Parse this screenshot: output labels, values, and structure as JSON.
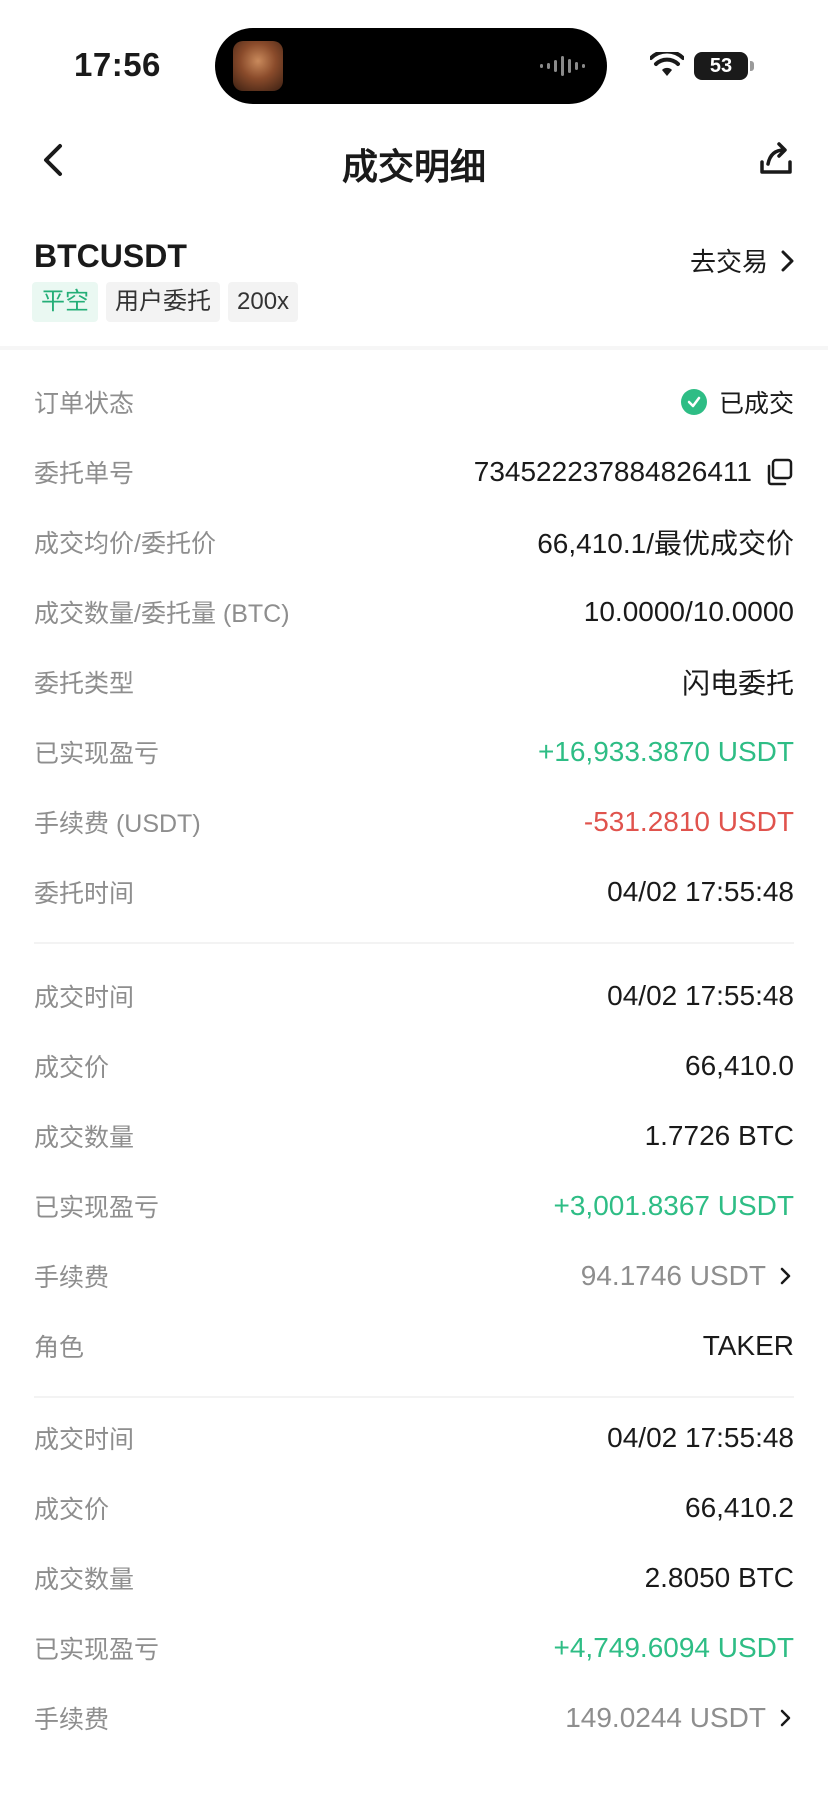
{
  "status_bar": {
    "time": "17:56",
    "battery": "53"
  },
  "nav": {
    "title": "成交明细"
  },
  "header": {
    "pair": "BTCUSDT",
    "goto_trade": "去交易",
    "tags": [
      "平空",
      "用户委托",
      "200x"
    ]
  },
  "order": {
    "status_label": "订单状态",
    "status_value": "已成交",
    "order_id_label": "委托单号",
    "order_id_value": "734522237884826411",
    "avg_price_label": "成交均价/委托价",
    "avg_price_value": "66,410.1/最优成交价",
    "qty_label": "成交数量/委托量 (BTC)",
    "qty_value": "10.0000/10.0000",
    "type_label": "委托类型",
    "type_value": "闪电委托",
    "pnl_label": "已实现盈亏",
    "pnl_value": "+16,933.3870 USDT",
    "fee_label": "手续费 (USDT)",
    "fee_value": "-531.2810 USDT",
    "time_label": "委托时间",
    "time_value": "04/02 17:55:48"
  },
  "fills": [
    {
      "time_label": "成交时间",
      "time_value": "04/02 17:55:48",
      "price_label": "成交价",
      "price_value": "66,410.0",
      "qty_label": "成交数量",
      "qty_value": "1.7726 BTC",
      "pnl_label": "已实现盈亏",
      "pnl_value": "+3,001.8367 USDT",
      "fee_label": "手续费",
      "fee_value": "94.1746 USDT",
      "role_label": "角色",
      "role_value": "TAKER"
    },
    {
      "time_label": "成交时间",
      "time_value": "04/02 17:55:48",
      "price_label": "成交价",
      "price_value": "66,410.2",
      "qty_label": "成交数量",
      "qty_value": "2.8050 BTC",
      "pnl_label": "已实现盈亏",
      "pnl_value": "+4,749.6094 USDT",
      "fee_label": "手续费",
      "fee_value": "149.0244 USDT"
    }
  ],
  "colors": {
    "profit": "#2ebd85",
    "loss": "#e0534d",
    "tag_green_bg": "#eaf8f2"
  }
}
